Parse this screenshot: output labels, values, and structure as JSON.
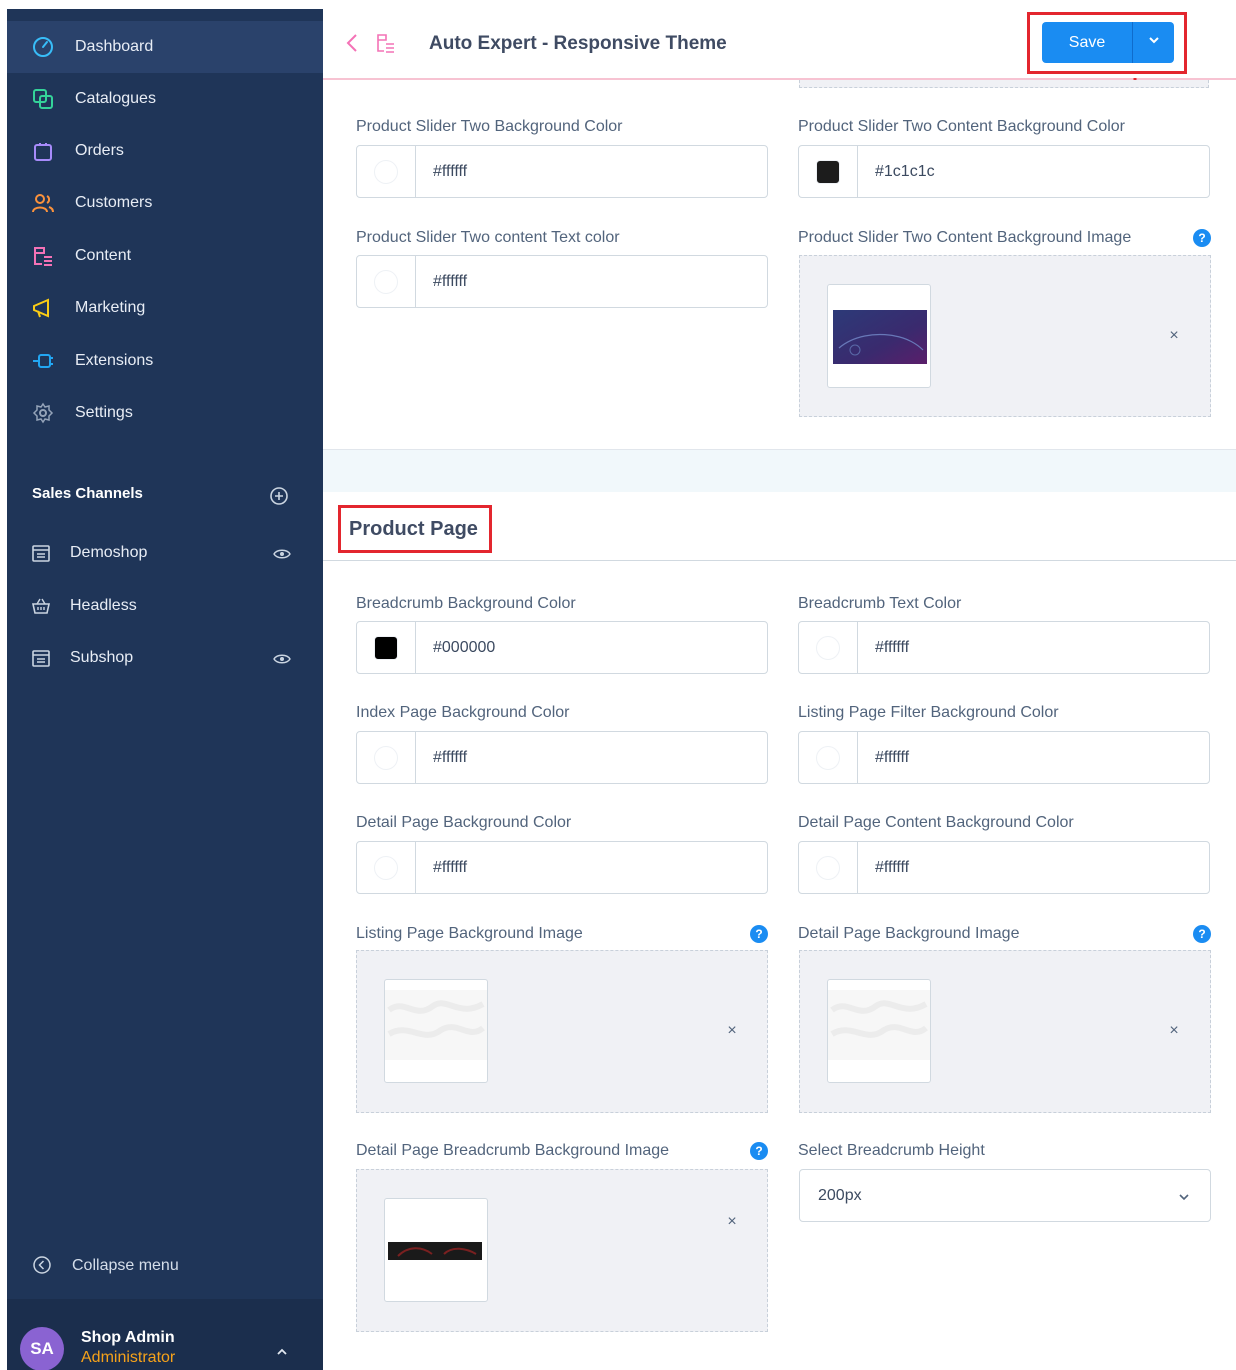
{
  "sidebar": {
    "nav": [
      {
        "label": "Dashboard",
        "icon": "dashboard-icon"
      },
      {
        "label": "Catalogues",
        "icon": "catalogues-icon"
      },
      {
        "label": "Orders",
        "icon": "orders-icon"
      },
      {
        "label": "Customers",
        "icon": "customers-icon"
      },
      {
        "label": "Content",
        "icon": "content-icon"
      },
      {
        "label": "Marketing",
        "icon": "marketing-icon"
      },
      {
        "label": "Extensions",
        "icon": "extensions-icon"
      },
      {
        "label": "Settings",
        "icon": "settings-icon"
      }
    ],
    "sales_channels_title": "Sales Channels",
    "channels": [
      {
        "label": "Demoshop"
      },
      {
        "label": "Headless"
      },
      {
        "label": "Subshop"
      }
    ],
    "collapse_label": "Collapse menu",
    "user": {
      "initials": "SA",
      "name": "Shop Admin",
      "role": "Administrator"
    }
  },
  "topbar": {
    "title": "Auto Expert - Responsive Theme",
    "save_label": "Save"
  },
  "fields": {
    "slider_bg": {
      "label": "Product Slider Two Background Color",
      "value": "#ffffff"
    },
    "slider_content_bg": {
      "label": "Product Slider Two Content Background Color",
      "value": "#1c1c1c"
    },
    "slider_text": {
      "label": "Product Slider Two content Text color",
      "value": "#ffffff"
    },
    "slider_bg_image": {
      "label": "Product Slider Two Content Background Image"
    },
    "section_title": "Product Page",
    "breadcrumb_bg": {
      "label": "Breadcrumb Background Color",
      "value": "#000000"
    },
    "breadcrumb_text": {
      "label": "Breadcrumb Text Color",
      "value": "#ffffff"
    },
    "index_bg": {
      "label": "Index Page Background Color",
      "value": "#ffffff"
    },
    "listing_filter_bg": {
      "label": "Listing Page Filter Background Color",
      "value": "#ffffff"
    },
    "detail_bg": {
      "label": "Detail Page Background Color",
      "value": "#ffffff"
    },
    "detail_content_bg": {
      "label": "Detail Page Content Background Color",
      "value": "#ffffff"
    },
    "listing_bg_image": {
      "label": "Listing Page Background Image"
    },
    "detail_bg_image": {
      "label": "Detail Page Background Image"
    },
    "detail_breadcrumb_image": {
      "label": "Detail Page Breadcrumb Background Image"
    },
    "breadcrumb_height": {
      "label": "Select Breadcrumb Height",
      "value": "200px"
    }
  },
  "colors": {
    "sidebar": "#1f3558",
    "accent": "#1a8cf2",
    "highlight": "#e3262e",
    "role": "#f6a21a"
  }
}
